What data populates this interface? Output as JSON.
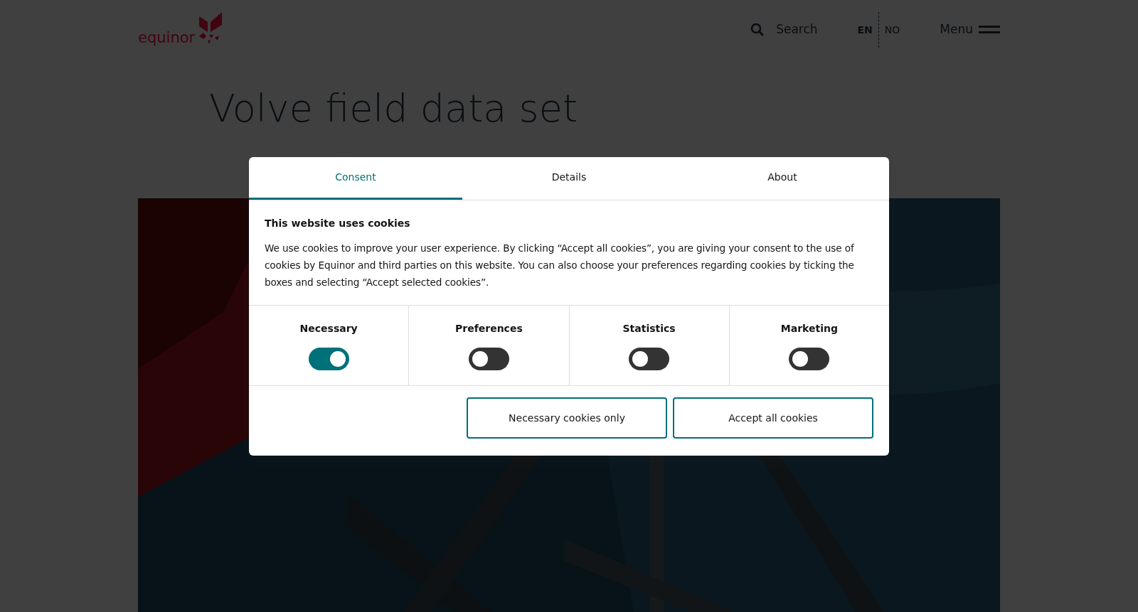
{
  "header": {
    "logo_text": "equinor",
    "search_label": "Search",
    "languages": [
      {
        "code": "EN",
        "selected": true
      },
      {
        "code": "NO",
        "selected": false
      }
    ],
    "menu_label": "Menu"
  },
  "page": {
    "title": "Volve field data set"
  },
  "cookie_dialog": {
    "tabs": [
      {
        "label": "Consent",
        "selected": true
      },
      {
        "label": "Details",
        "selected": false
      },
      {
        "label": "About",
        "selected": false
      }
    ],
    "heading": "This website uses cookies",
    "text": "We use cookies to improve your user experience. By clicking “Accept all cookies”, you are giving your consent to the use of cookies by Equinor and third parties on this website. You can also choose your preferences regarding cookies by ticking the boxes and selecting “Accept selected cookies”.",
    "categories": [
      {
        "label": "Necessary",
        "on": true
      },
      {
        "label": "Preferences",
        "on": false
      },
      {
        "label": "Statistics",
        "on": false
      },
      {
        "label": "Marketing",
        "on": false
      }
    ],
    "buttons": [
      "Necessary cookies only",
      "Accept all cookies"
    ]
  }
}
